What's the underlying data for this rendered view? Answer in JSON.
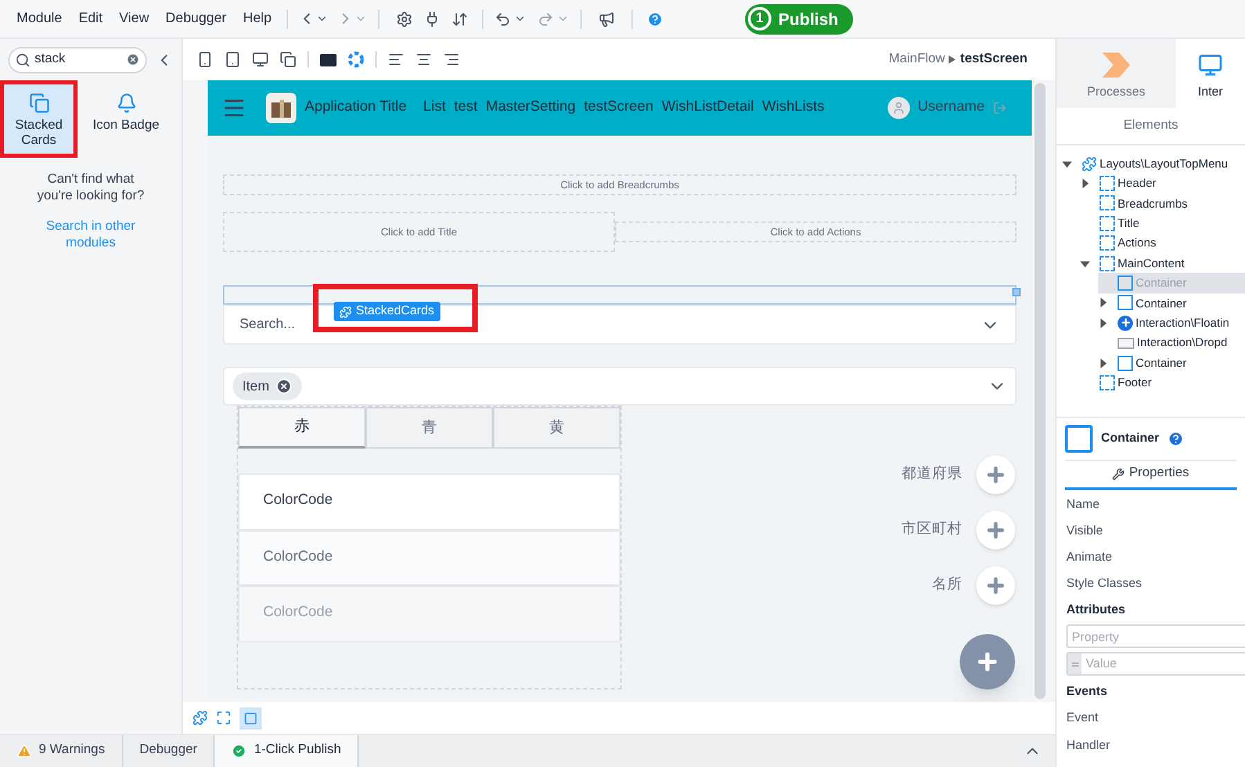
{
  "menu": [
    "Module",
    "Edit",
    "View",
    "Debugger",
    "Help"
  ],
  "publish": {
    "step": "1",
    "label": "Publish"
  },
  "widget_search": {
    "value": "stack"
  },
  "widgets": [
    {
      "label": "Stacked Cards",
      "kind": "cards",
      "selected": true
    },
    {
      "label": "Icon Badge",
      "kind": "badge",
      "selected": false
    }
  ],
  "no_result_text": "Can't find what you're looking for?",
  "search_other_link": "Search in other modules",
  "breadcrumb": [
    "MainFlow",
    "testScreen"
  ],
  "app_header": {
    "title": "Application Title",
    "menu": [
      "List",
      "test",
      "MasterSetting",
      "testScreen",
      "WishListDetail",
      "WishLists"
    ],
    "username": "Username"
  },
  "placeholders": {
    "breadcrumbs": "Click to add Breadcrumbs",
    "title": "Click to add Title",
    "actions": "Click to add Actions"
  },
  "drag_label": "StackedCards",
  "search_dropdown": {
    "placeholder": "Search..."
  },
  "tag_dropdown": {
    "chip": "Item"
  },
  "color_tabs": [
    {
      "label": "赤",
      "selected": true
    },
    {
      "label": "青",
      "selected": false
    },
    {
      "label": "黄",
      "selected": false
    }
  ],
  "cards": [
    {
      "label": "ColorCode",
      "kind": "front"
    },
    {
      "label": "ColorCode",
      "kind": "middle"
    },
    {
      "label": "ColorCode",
      "kind": "back"
    }
  ],
  "add_rows": [
    {
      "label": "都道府県"
    },
    {
      "label": "市区町村"
    },
    {
      "label": "名所"
    }
  ],
  "right_tabs": [
    {
      "label": "Processes",
      "kind": "processes",
      "selected": false
    },
    {
      "label": "Inter",
      "kind": "interface",
      "selected": true
    }
  ],
  "elements_title": "Elements",
  "tree": [
    {
      "label": "Layouts\\LayoutTopMenu",
      "kind": "block",
      "expanded": true,
      "selected": false,
      "children": [
        {
          "label": "Header",
          "kind": "placeholder",
          "expanded": false,
          "selected": false
        },
        {
          "label": "Breadcrumbs",
          "kind": "placeholder",
          "selected": false
        },
        {
          "label": "Title",
          "kind": "placeholder",
          "selected": false
        },
        {
          "label": "Actions",
          "kind": "placeholder",
          "selected": false
        },
        {
          "label": "MainContent",
          "kind": "placeholder",
          "expanded": true,
          "selected": false,
          "children": [
            {
              "label": "Container",
              "kind": "container",
              "selected": true
            },
            {
              "label": "Container",
              "kind": "container",
              "expanded": false,
              "selected": false
            },
            {
              "label": "Interaction\\Floatin",
              "kind": "floating",
              "expanded": false,
              "selected": false
            },
            {
              "label": "Interaction\\Dropd",
              "kind": "dropdown",
              "selected": false
            },
            {
              "label": "Container",
              "kind": "container",
              "expanded": false,
              "selected": false
            }
          ]
        },
        {
          "label": "Footer",
          "kind": "placeholder",
          "selected": false
        }
      ]
    }
  ],
  "properties": {
    "element": "Container",
    "tab": "Properties",
    "fields": [
      "Name",
      "Visible",
      "Animate",
      "Style Classes"
    ],
    "attributes_title": "Attributes",
    "property_placeholder": "Property",
    "value_placeholder": "Value",
    "events_title": "Events",
    "event_fields": [
      "Event",
      "Handler"
    ]
  },
  "bottom_tabs": [
    {
      "label": "9 Warnings",
      "kind": "warning",
      "selected": false
    },
    {
      "label": "Debugger",
      "kind": "plain",
      "selected": false
    },
    {
      "label": "1-Click Publish",
      "kind": "success",
      "selected": true
    }
  ]
}
